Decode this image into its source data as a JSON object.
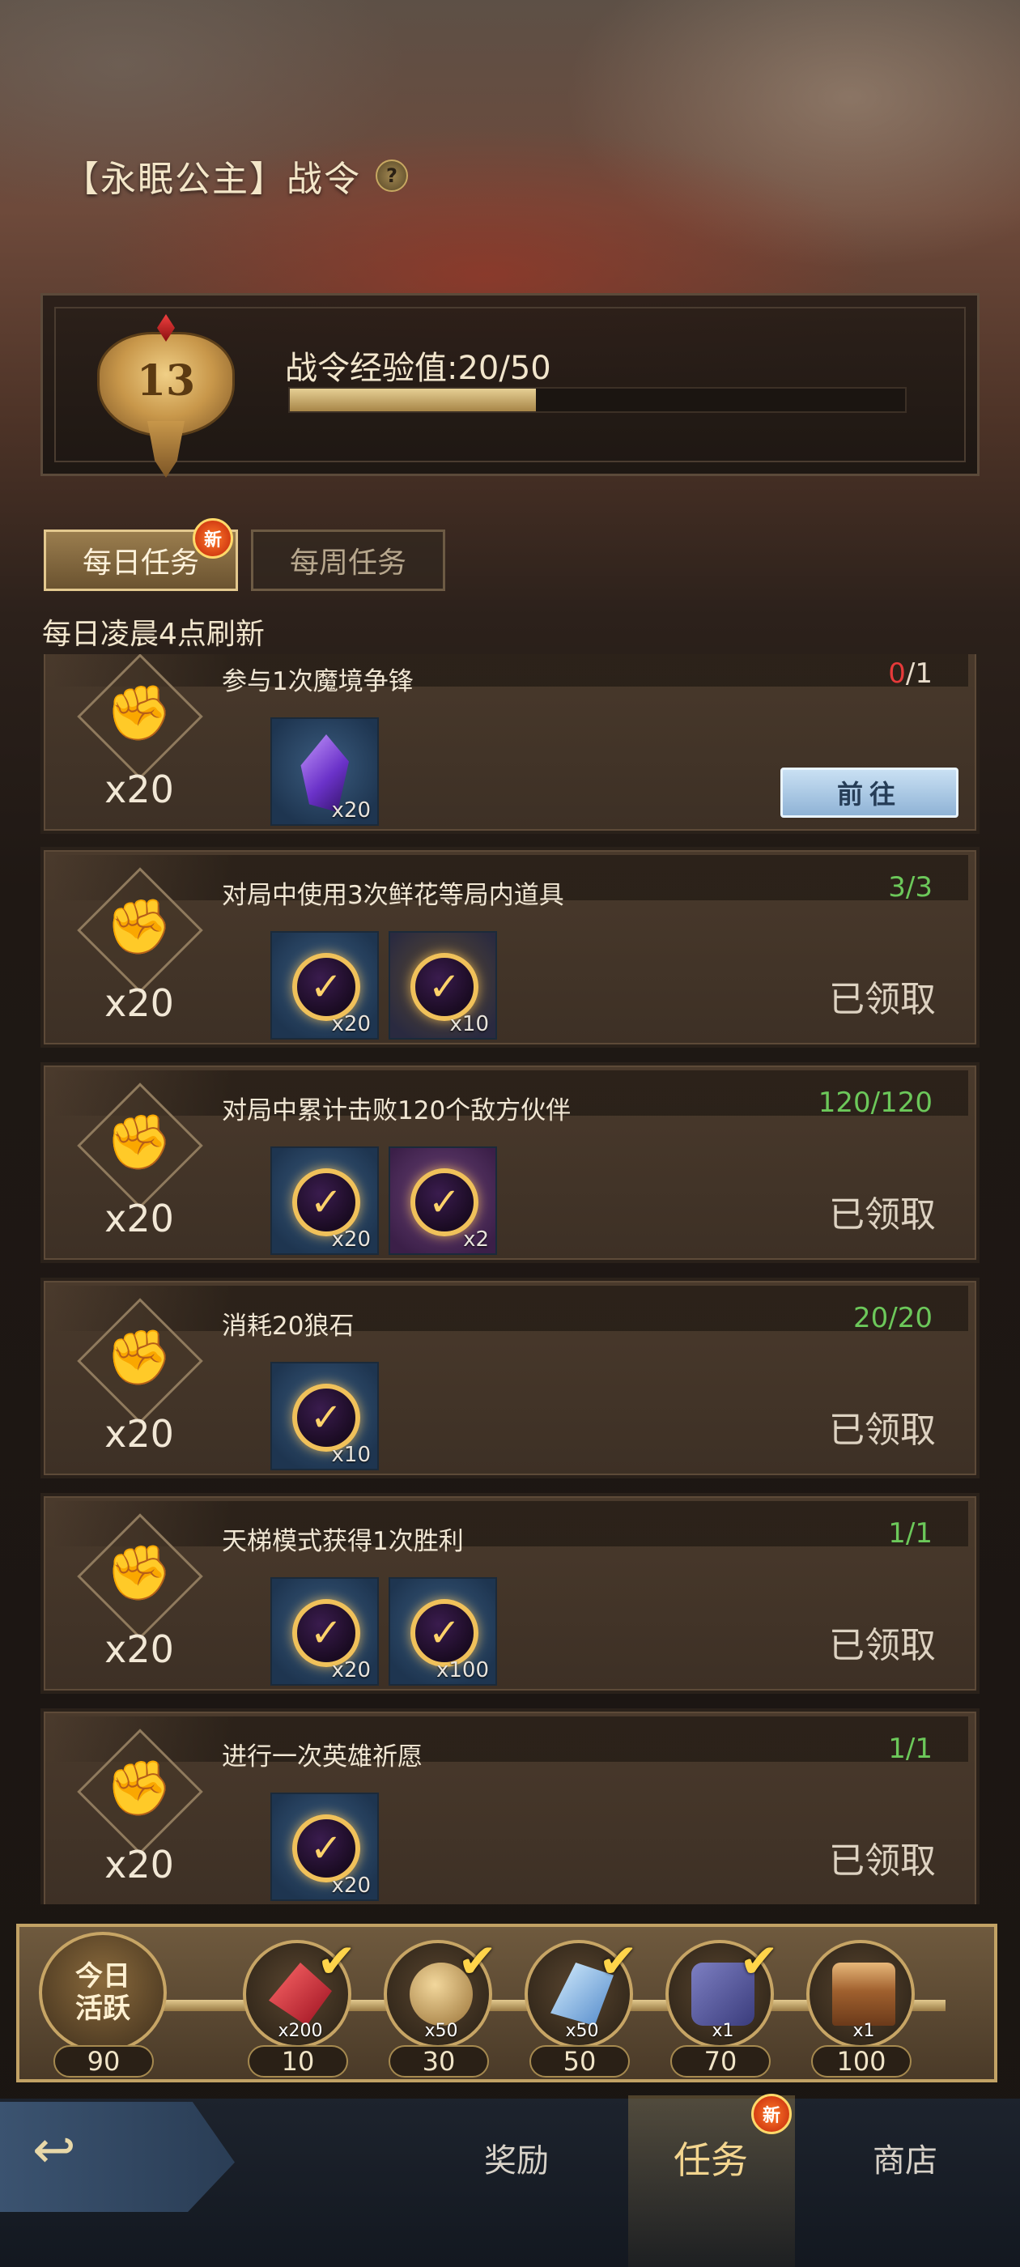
{
  "header": {
    "title": "【永眠公主】战令",
    "help_icon": "question-icon"
  },
  "level": {
    "number": "13",
    "exp_label": "战令经验值:20/50",
    "exp_progress": 0.4
  },
  "tabs": [
    {
      "label": "每日任务",
      "active": true,
      "new_badge": "新"
    },
    {
      "label": "每周任务",
      "active": false
    }
  ],
  "refresh_note": "每日凌晨4点刷新",
  "tasks": [
    {
      "title": "参与1次魔境争锋",
      "progress_current": "0",
      "progress_total": "/1",
      "points": "x20",
      "rewards": [
        {
          "icon": "purple-crystal-icon",
          "qty": "x20"
        }
      ],
      "status": "前往"
    },
    {
      "title": "对局中使用3次鲜花等局内道具",
      "progress": "3/3",
      "points": "x20",
      "rewards": [
        {
          "icon": "exp-coin-icon",
          "qty": "x20"
        },
        {
          "icon": "exp-coin-icon",
          "qty": "x10"
        }
      ],
      "status": "已领取"
    },
    {
      "title": "对局中累计击败120个敌方伙伴",
      "progress": "120/120",
      "points": "x20",
      "rewards": [
        {
          "icon": "exp-coin-icon",
          "qty": "x20"
        },
        {
          "icon": "exp-card-icon",
          "qty": "x2"
        }
      ],
      "status": "已领取"
    },
    {
      "title": "消耗20狼石",
      "progress": "20/20",
      "points": "x20",
      "rewards": [
        {
          "icon": "exp-coin-icon",
          "qty": "x10"
        }
      ],
      "status": "已领取"
    },
    {
      "title": "天梯模式获得1次胜利",
      "progress": "1/1",
      "points": "x20",
      "rewards": [
        {
          "icon": "exp-coin-icon",
          "qty": "x20"
        },
        {
          "icon": "exp-coin-icon",
          "qty": "x100"
        }
      ],
      "status": "已领取"
    },
    {
      "title": "进行一次英雄祈愿",
      "progress": "1/1",
      "points": "x20",
      "rewards": [
        {
          "icon": "exp-coin-icon",
          "qty": "x20"
        }
      ],
      "status": "已领取"
    }
  ],
  "activity": {
    "today_label_1": "今日",
    "today_label_2": "活跃",
    "today_value": "90",
    "milestones": [
      {
        "icon": "red-gem-icon",
        "qty": "x200",
        "value": "10",
        "claimed": true
      },
      {
        "icon": "gold-coin-icon",
        "qty": "x50",
        "value": "30",
        "claimed": true
      },
      {
        "icon": "blue-crystal-icon",
        "qty": "x50",
        "value": "50",
        "claimed": true
      },
      {
        "icon": "puzzle-piece-icon",
        "qty": "x1",
        "value": "70",
        "claimed": true
      },
      {
        "icon": "treasure-chest-icon",
        "qty": "x1",
        "value": "100",
        "claimed": false
      }
    ]
  },
  "nav": {
    "items": [
      {
        "label": "奖励",
        "active": false
      },
      {
        "label": "任务",
        "active": true,
        "new_badge": "新"
      },
      {
        "label": "商店",
        "active": false
      }
    ]
  },
  "colors": {
    "progress_done": "#6cc85a",
    "progress_incomplete": "#e63a3a",
    "gold_accent": "#c7a565"
  }
}
